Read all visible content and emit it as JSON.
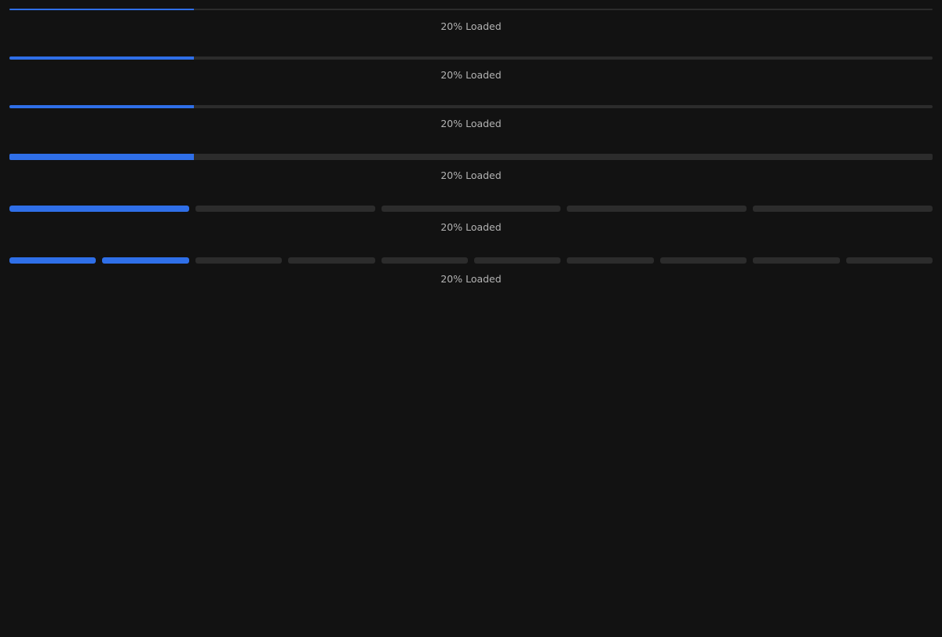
{
  "colors": {
    "background": "#121212",
    "track": "#2c2c2c",
    "fill": "#2f6fe8",
    "text": "#b3b3b3"
  },
  "progress_bars": [
    {
      "variant": "line",
      "progress": 0.2,
      "label": "20% Loaded"
    },
    {
      "variant": "line",
      "progress": 0.2,
      "label": "20% Loaded"
    },
    {
      "variant": "line",
      "progress": 0.2,
      "label": "20% Loaded"
    },
    {
      "variant": "line",
      "progress": 0.2,
      "label": "20% Loaded"
    },
    {
      "variant": "segmented",
      "segments": 5,
      "filled": 1,
      "label": "20% Loaded"
    },
    {
      "variant": "segmented",
      "segments": 10,
      "filled": 2,
      "label": "20% Loaded"
    }
  ]
}
